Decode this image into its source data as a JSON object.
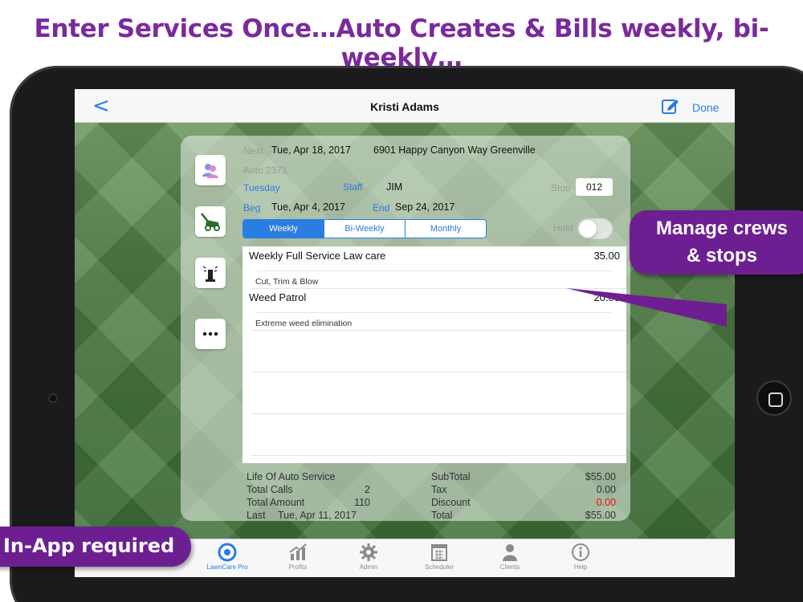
{
  "headline": "Enter Services Once…Auto Creates & Bills weekly, bi-weekly…",
  "nav": {
    "back": "<",
    "title": "Kristi Adams",
    "done": "Done"
  },
  "detail": {
    "next_label": "Next",
    "next_date": "Tue, Apr 18, 2017",
    "address": "6901 Happy Canyon Way Greenville",
    "auto_id": "Auto 2371",
    "day": "Tuesday",
    "staff_label": "Staff",
    "staff_value": "JIM",
    "stop_label": "Stop",
    "stop_value": "012",
    "beg_label": "Beg",
    "beg_date": "Tue, Apr 4, 2017",
    "end_label": "End",
    "end_date": "Sep 24, 2017",
    "frequency": [
      "Weekly",
      "Bi-Weekly",
      "Monthly"
    ],
    "frequency_selected": "Weekly",
    "hold_label": "Hold",
    "hold_on": false
  },
  "services": [
    {
      "name": "Weekly Full Service Law care",
      "price": "35.00",
      "description": "Cut, Trim & Blow"
    },
    {
      "name": "Weed Patrol",
      "price": "20.00",
      "description": "Extreme weed elimination"
    }
  ],
  "summary": {
    "life_label": "Life Of Auto Service",
    "total_calls_label": "Total Calls",
    "total_calls": "2",
    "total_amount_label": "Total Amount",
    "total_amount": "110",
    "last_label": "Last",
    "last_date": "Tue, Apr 11, 2017",
    "subtotal_label": "SubTotal",
    "subtotal": "$55.00",
    "tax_label": "Tax",
    "tax": "0.00",
    "discount_label": "Discount",
    "discount": "0.00",
    "total_label": "Total",
    "total": "$55.00"
  },
  "tabs": [
    "LawnCare Pro",
    "Profits",
    "Admin",
    "Scheduler",
    "Clients",
    "Help"
  ],
  "tab_active": "LawnCare Pro",
  "callouts": {
    "crews_line1": "Manage crews",
    "crews_line2": "& stops",
    "inapp": "In-App required"
  },
  "colors": {
    "accent": "#2a7de1",
    "callout": "#6d1f91",
    "headline": "#7a2a9c",
    "discount": "#e01010"
  }
}
